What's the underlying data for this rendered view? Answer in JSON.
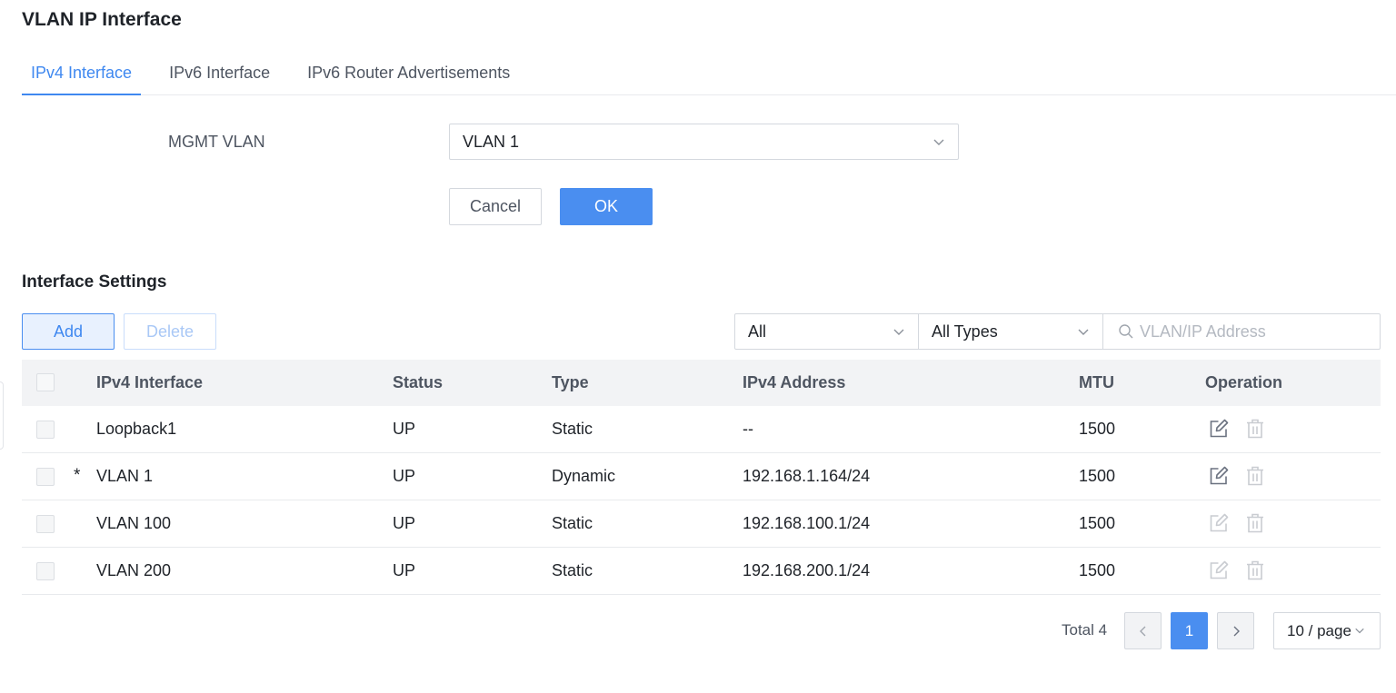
{
  "page": {
    "title": "VLAN IP Interface"
  },
  "tabs": [
    {
      "label": "IPv4 Interface",
      "active": true
    },
    {
      "label": "IPv6 Interface",
      "active": false
    },
    {
      "label": "IPv6 Router Advertisements",
      "active": false
    }
  ],
  "mgmt": {
    "label": "MGMT VLAN",
    "selected": "VLAN 1",
    "cancel_label": "Cancel",
    "ok_label": "OK"
  },
  "interface_settings": {
    "title": "Interface Settings",
    "add_label": "Add",
    "delete_label": "Delete",
    "filter_status": "All",
    "filter_type": "All Types",
    "search_placeholder": "VLAN/IP Address"
  },
  "table": {
    "headers": {
      "name": "IPv4 Interface",
      "status": "Status",
      "type": "Type",
      "ip": "IPv4 Address",
      "mtu": "MTU",
      "operation": "Operation"
    },
    "rows": [
      {
        "marker": "",
        "name": "Loopback1",
        "status": "UP",
        "type": "Static",
        "ip": "--",
        "mtu": "1500",
        "edit_enabled": true
      },
      {
        "marker": "*",
        "name": "VLAN 1",
        "status": "UP",
        "type": "Dynamic",
        "ip": "192.168.1.164/24",
        "mtu": "1500",
        "edit_enabled": true
      },
      {
        "marker": "",
        "name": "VLAN 100",
        "status": "UP",
        "type": "Static",
        "ip": "192.168.100.1/24",
        "mtu": "1500",
        "edit_enabled": false
      },
      {
        "marker": "",
        "name": "VLAN 200",
        "status": "UP",
        "type": "Static",
        "ip": "192.168.200.1/24",
        "mtu": "1500",
        "edit_enabled": false
      }
    ]
  },
  "pagination": {
    "total_label": "Total 4",
    "current_page": "1",
    "page_size": "10 / page"
  },
  "colors": {
    "accent": "#4a8ef0",
    "icon_active": "#6b7280",
    "icon_disabled": "#c9ccd1"
  }
}
